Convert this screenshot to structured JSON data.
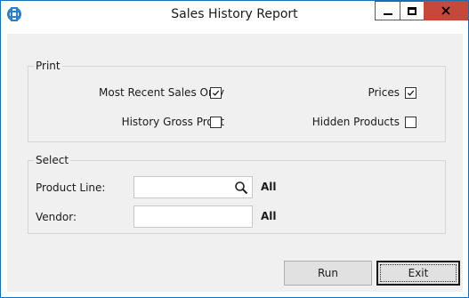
{
  "window": {
    "title": "Sales History Report"
  },
  "titlebar_icons": [
    "app-logo-icon",
    "minimize-icon",
    "maximize-icon",
    "close-icon"
  ],
  "print_group": {
    "label": "Print",
    "options": [
      {
        "label": "Most Recent Sales Only",
        "checked": true
      },
      {
        "label": "Prices",
        "checked": true
      },
      {
        "label": "History Gross Profit",
        "checked": false
      },
      {
        "label": "Hidden Products",
        "checked": false
      }
    ]
  },
  "select_group": {
    "label": "Select",
    "product_line": {
      "label": "Product Line:",
      "value": "",
      "status": "All"
    },
    "vendor": {
      "label": "Vendor:",
      "value": "",
      "status": "All"
    }
  },
  "buttons": {
    "run": "Run",
    "exit": "Exit"
  },
  "colors": {
    "close_button": "#c7483b",
    "accent": "#1b6fb0",
    "client_bg": "#f0f0f0"
  }
}
